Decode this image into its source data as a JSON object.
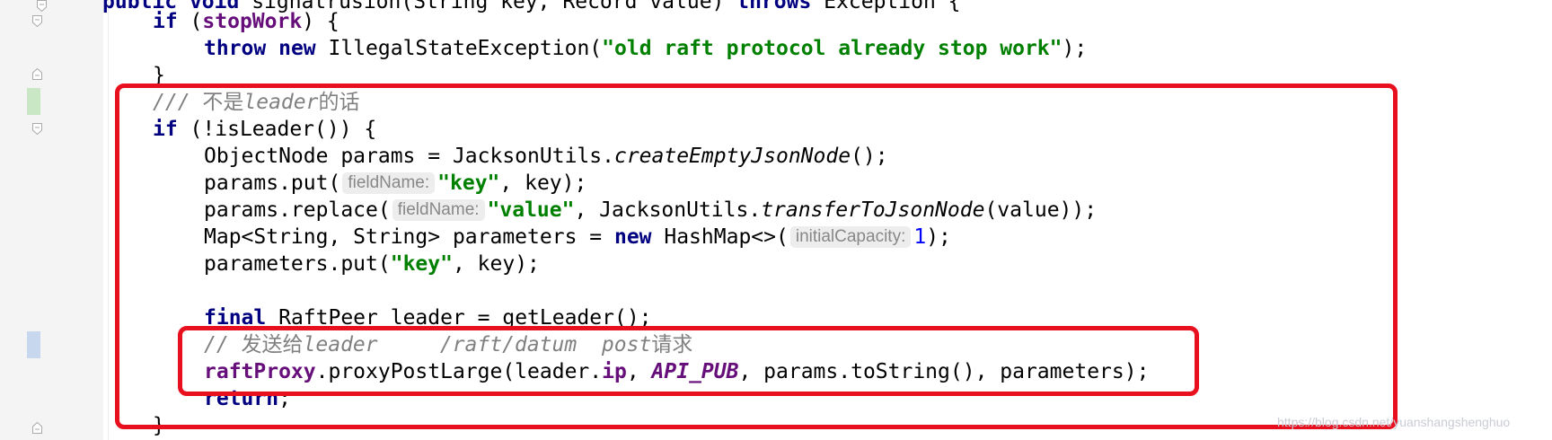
{
  "colors": {
    "keyword": "#000080",
    "field": "#660e7a",
    "string": "#008000",
    "number": "#0000ff",
    "comment": "#808080",
    "highlight_box": "#e8101e",
    "change_marker_added": "#c9e7c5",
    "change_marker_modified": "#c7d7ee"
  },
  "code": {
    "line0": {
      "kw_public": "public",
      "kw_void": "void",
      "name": " signatrusion(String key, Record value) ",
      "kw_throws": "throws",
      "rest": " Exception {"
    },
    "line1": {
      "kw_if": "if",
      "open": " (",
      "field": "stopWork",
      "close": ") {"
    },
    "line2": {
      "kw_throw": "throw",
      "kw_new": "new",
      "cls": " IllegalStateException(",
      "str": "\"old raft protocol already stop work\"",
      "end": ");"
    },
    "line3": {
      "brace": "}"
    },
    "line4": {
      "comment_prefix": "/// ",
      "cjk1": "不是",
      "word": "leader",
      "cjk2": "的话"
    },
    "line5": {
      "kw_if": "if",
      "rest": " (!isLeader()) {"
    },
    "line6": {
      "pre": "ObjectNode params = JacksonUtils.",
      "method": "createEmptyJsonNode",
      "end": "();"
    },
    "line7": {
      "pre": "params.put(",
      "hint": "fieldName:",
      "str": "\"key\"",
      "end": ", key);"
    },
    "line8": {
      "pre": "params.replace(",
      "hint": "fieldName:",
      "str": "\"value\"",
      "mid": ", JacksonUtils.",
      "method": "transferToJsonNode",
      "end": "(value));"
    },
    "line9": {
      "pre": "Map<String, String> parameters = ",
      "kw_new": "new",
      "mid": " HashMap<>(",
      "hint": "initialCapacity:",
      "num": "1",
      "end": ");"
    },
    "line10": {
      "pre": "parameters.put(",
      "str": "\"key\"",
      "end": ", key);"
    },
    "line12": {
      "kw_final": "final",
      "rest": " RaftPeer leader = getLeader();"
    },
    "line13": {
      "comment_prefix": "// ",
      "cjk1": "发送给",
      "text": "leader     /raft/datum  post",
      "cjk2": "请求"
    },
    "line14": {
      "field": "raftProxy",
      "mid1": ".proxyPostLarge(leader.",
      "field2": "ip",
      "mid2": ", ",
      "const": "API_PUB",
      "end": ", params.toString(), parameters);"
    },
    "line15": {
      "kw_return": "return",
      "end": ";"
    },
    "line16": {
      "brace": "}"
    }
  },
  "watermark": "https://blog.csdn.net/yuanshangshenghuo"
}
